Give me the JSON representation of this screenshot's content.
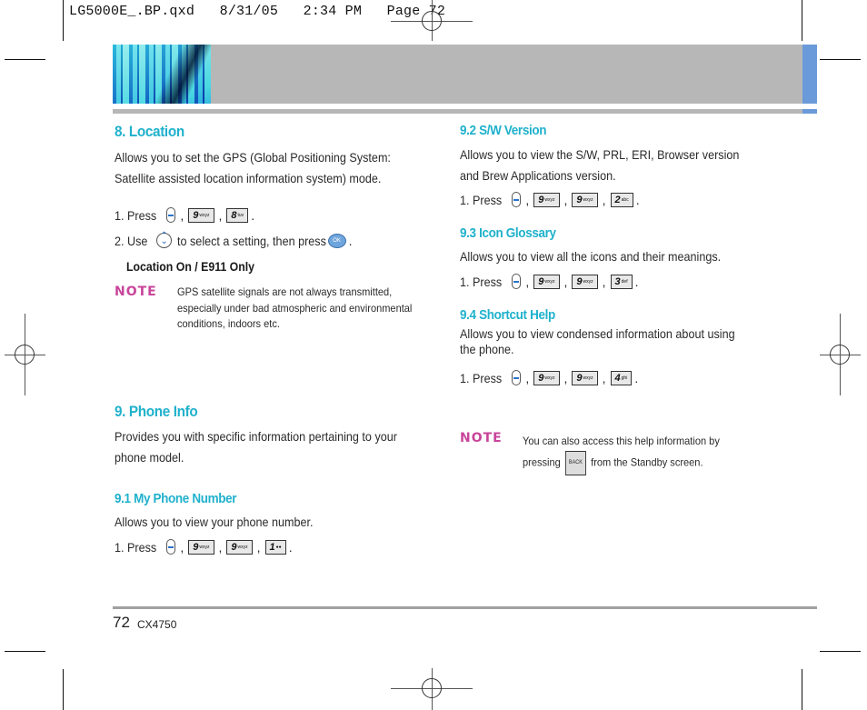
{
  "print_slug": "LG5000E_.BP.qxd   8/31/05   2:34 PM   Page 72",
  "colors": {
    "heading": "#1fb1cc",
    "note": "#c8459a",
    "banner_gray": "#b7b7b7",
    "banner_blue": "#6a9ad9"
  },
  "left": {
    "location": {
      "title": "8. Location",
      "desc_lines": [
        "Allows you to set the GPS (Global Positioning System:",
        "Satellite assisted location information system) mode."
      ],
      "step1_label": "1. Press",
      "step1_keys": [
        "9wxyz",
        "8tuv"
      ],
      "step2_label": "2. Use",
      "step2_mid": "to select a setting, then press",
      "step2_end": ".",
      "ok_label": "OK",
      "options": "Location On / E911 Only",
      "note_label": "NOTE",
      "note_lines": [
        "GPS satellite signals are not always transmitted,",
        "especially under bad atmospheric and environmental",
        "conditions, indoors etc."
      ]
    },
    "phone_info": {
      "title": "9. Phone Info",
      "desc_lines": [
        "Provides you with specific information pertaining to your",
        "phone model."
      ]
    },
    "my_number": {
      "title": "9.1 My Phone Number",
      "desc": "Allows you to view your phone number.",
      "step_label": "1. Press",
      "keys": [
        "9wxyz",
        "9wxyz",
        "1"
      ]
    }
  },
  "right": {
    "sw_version": {
      "title": "9.2 S/W Version",
      "desc_lines": [
        "Allows you to view the S/W, PRL, ERI, Browser version",
        "and Brew Applications version."
      ],
      "step_label": "1. Press",
      "keys": [
        "9wxyz",
        "9wxyz",
        "2abc"
      ]
    },
    "icon_glossary": {
      "title": "9.3 Icon Glossary",
      "desc": "Allows you to view all the icons and their meanings.",
      "step_label": "1. Press",
      "keys": [
        "9wxyz",
        "9wxyz",
        "3def"
      ]
    },
    "shortcut_help": {
      "title": "9.4 Shortcut Help",
      "desc_lines": [
        "Allows you to view condensed information about using",
        "the phone."
      ],
      "step_label": "1. Press",
      "keys": [
        "9wxyz",
        "9wxyz",
        "4ghi"
      ]
    },
    "note": {
      "label": "NOTE",
      "line1": "You can also access this help information by",
      "line2_start": "pressing",
      "back_key": "BACK",
      "line2_end": "from the Standby screen."
    }
  },
  "footer": {
    "page_number": "72",
    "model": "CX4750"
  },
  "punct": {
    "comma": ",",
    "period": "."
  }
}
